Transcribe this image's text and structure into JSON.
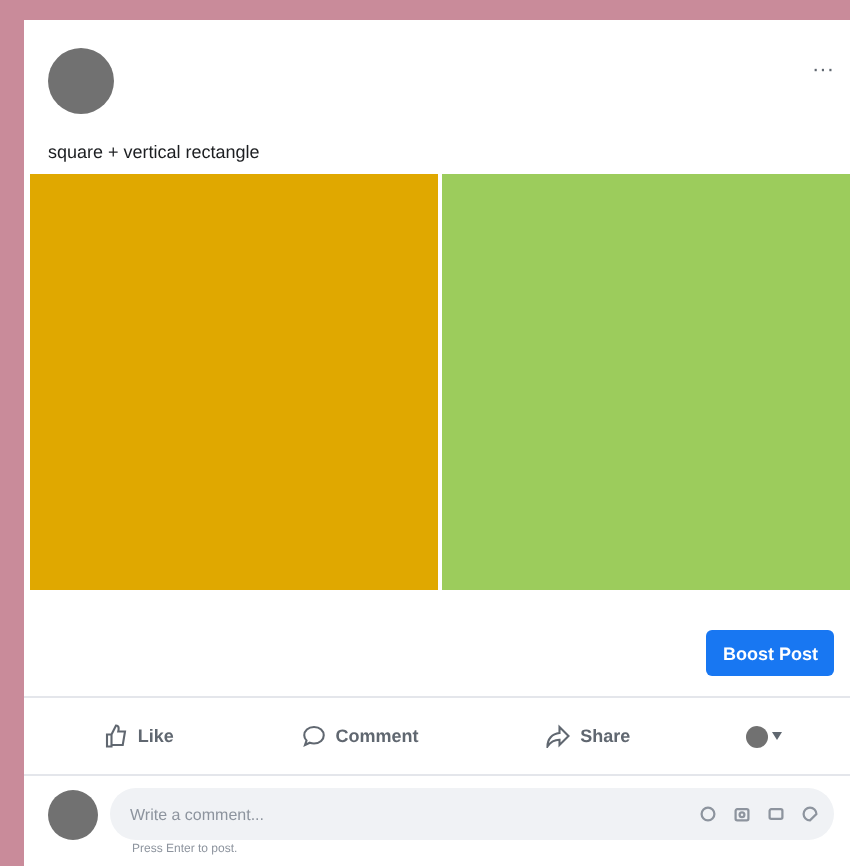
{
  "post": {
    "menu": "···",
    "caption": "square + vertical rectangle",
    "tiles": [
      {
        "color": "#e0a800"
      },
      {
        "color": "#9ccc5c"
      }
    ],
    "boost_button": "Boost Post",
    "actions": [
      {
        "kind": "like",
        "label": "Like"
      },
      {
        "kind": "comment",
        "label": "Comment"
      },
      {
        "kind": "share",
        "label": "Share"
      }
    ],
    "comment": {
      "placeholder": "Write a comment...",
      "hint": "Press Enter to post."
    }
  }
}
